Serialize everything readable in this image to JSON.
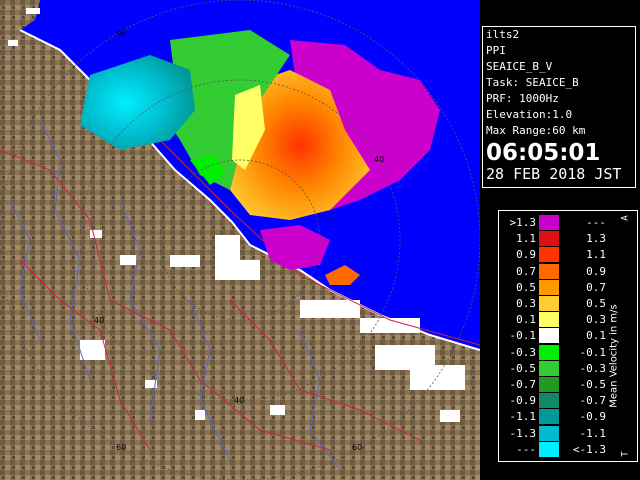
{
  "radar": {
    "ring_labels": [
      "60",
      "40",
      "40",
      "40",
      "60",
      "60"
    ]
  },
  "info": {
    "site": "ilts2",
    "scan_mode": "PPI",
    "product": "SEAICE_B_V",
    "task": "Task: SEAICE_B",
    "prf": "PRF: 1000Hz",
    "elevation": "Elevation:1.0",
    "max_range": "Max Range:60 km",
    "time": "06:05:01",
    "date": "28 FEB 2018 JST"
  },
  "legend": {
    "unit": "Mean Velocity in m/s",
    "top_tick": "A",
    "bottom_tick": "T",
    "rows": [
      {
        "left": ">1.3",
        "right": "---",
        "color": "#cc00cc"
      },
      {
        "left": "1.1",
        "right": "1.3",
        "color": "#dd1111"
      },
      {
        "left": "0.9",
        "right": "1.1",
        "color": "#ff3300"
      },
      {
        "left": "0.7",
        "right": "0.9",
        "color": "#ff6a00"
      },
      {
        "left": "0.5",
        "right": "0.7",
        "color": "#ff9900"
      },
      {
        "left": "0.3",
        "right": "0.5",
        "color": "#ffcc33"
      },
      {
        "left": "0.1",
        "right": "0.3",
        "color": "#ffff66"
      },
      {
        "left": "-0.1",
        "right": "0.1",
        "color": "#ffffff"
      },
      {
        "left": "-0.3",
        "right": "-0.1",
        "color": "#00ee00"
      },
      {
        "left": "-0.5",
        "right": "-0.3",
        "color": "#33cc33"
      },
      {
        "left": "-0.7",
        "right": "-0.5",
        "color": "#229922"
      },
      {
        "left": "-0.9",
        "right": "-0.7",
        "color": "#118866"
      },
      {
        "left": "-1.1",
        "right": "-0.9",
        "color": "#009999"
      },
      {
        "left": "-1.3",
        "right": "-1.1",
        "color": "#00bbcc"
      },
      {
        "left": "---",
        "right": "<-1.3",
        "color": "#00eeff"
      }
    ]
  },
  "colors": {
    "sea": "#0000ff",
    "land": "#8a7352",
    "land_dark": "#5e4a33",
    "roads": "#cc2244",
    "rivers": "#5566cc"
  }
}
